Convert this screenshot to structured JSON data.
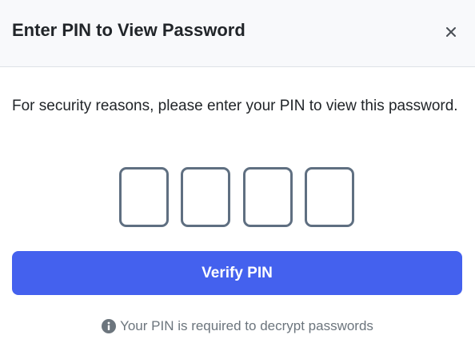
{
  "dialog": {
    "title": "Enter PIN to View Password",
    "close_label": "×"
  },
  "body": {
    "message": "For security reasons, please enter your PIN to view this password.",
    "pin_inputs": [
      {
        "value": ""
      },
      {
        "value": ""
      },
      {
        "value": ""
      },
      {
        "value": ""
      }
    ],
    "verify_button_label": "Verify PIN",
    "hint_icon": "info-circle-icon",
    "hint_text": "Your PIN is required to decrypt passwords"
  },
  "colors": {
    "accent": "#4461ee",
    "pin_border": "#5f6f81",
    "hint_text": "#6c757d",
    "header_bg": "#f8f9fb"
  }
}
